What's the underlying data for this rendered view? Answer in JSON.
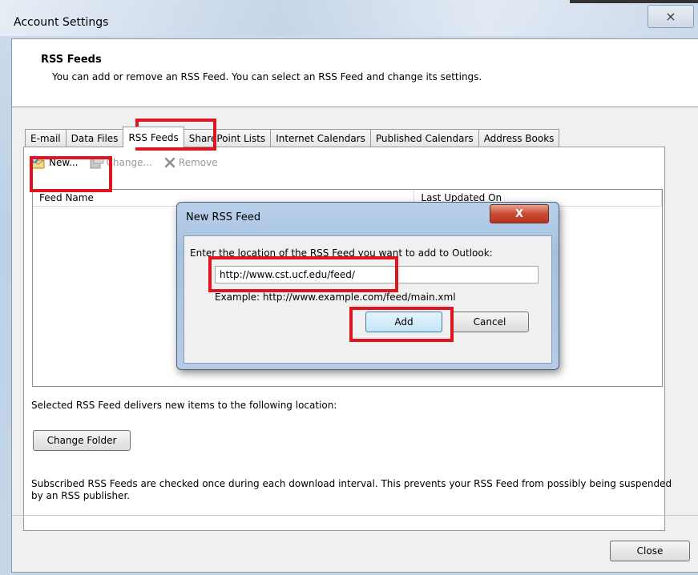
{
  "window": {
    "title": "Account Settings",
    "close_glyph": "⨯",
    "colors": {
      "highlight": "#e0141e",
      "dialog_close": "#c94b33",
      "primary_button_border": "#3c7fb1"
    }
  },
  "header": {
    "title": "RSS Feeds",
    "description": "You can add or remove an RSS Feed. You can select an RSS Feed and change its settings."
  },
  "tabs": [
    {
      "label": "E-mail"
    },
    {
      "label": "Data Files"
    },
    {
      "label": "RSS Feeds",
      "active": true
    },
    {
      "label": "SharePoint Lists"
    },
    {
      "label": "Internet Calendars"
    },
    {
      "label": "Published Calendars"
    },
    {
      "label": "Address Books"
    }
  ],
  "toolbar": {
    "new_label": "New...",
    "new_icon": "new-feed-icon",
    "change_label": "Change...",
    "change_icon": "change-icon",
    "remove_label": "Remove",
    "remove_icon": "remove-x-icon"
  },
  "list": {
    "columns": [
      "Feed Name",
      "Last Updated On"
    ]
  },
  "delivery_text": "Selected RSS Feed delivers new items to the following location:",
  "change_folder_label": "Change Folder",
  "footer_text": "Subscribed RSS Feeds are checked once during each download interval. This prevents your RSS Feed from possibly being suspended by an RSS publisher.",
  "close_label": "Close",
  "dialog": {
    "title": "New RSS Feed",
    "close_glyph": "X",
    "prompt": "Enter the location of the RSS Feed you want to add to Outlook:",
    "url_value": "http://www.cst.ucf.edu/feed/",
    "example": "Example: http://www.example.com/feed/main.xml",
    "add_label": "Add",
    "cancel_label": "Cancel"
  }
}
